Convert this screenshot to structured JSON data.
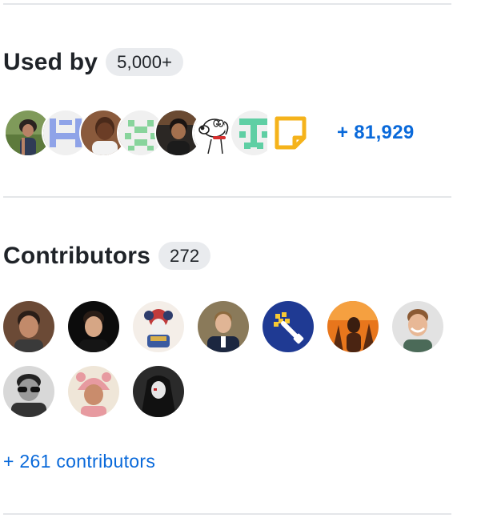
{
  "used_by": {
    "title": "Used by",
    "count": "5,000+",
    "more": "+ 81,929",
    "avatars": [
      {
        "name": "user-avatar-1",
        "kind": "photo"
      },
      {
        "name": "user-avatar-2",
        "kind": "identicon"
      },
      {
        "name": "user-avatar-3",
        "kind": "photo"
      },
      {
        "name": "user-avatar-4",
        "kind": "identicon"
      },
      {
        "name": "user-avatar-5",
        "kind": "photo"
      },
      {
        "name": "user-avatar-6",
        "kind": "cartoon-dog"
      },
      {
        "name": "user-avatar-7",
        "kind": "identicon"
      },
      {
        "name": "user-avatar-8",
        "kind": "logo"
      }
    ]
  },
  "contributors": {
    "title": "Contributors",
    "count": "272",
    "more": "+ 261 contributors",
    "avatars": [
      {
        "name": "contributor-avatar-1",
        "kind": "photo"
      },
      {
        "name": "contributor-avatar-2",
        "kind": "photo"
      },
      {
        "name": "contributor-avatar-3",
        "kind": "illustration"
      },
      {
        "name": "contributor-avatar-4",
        "kind": "photo"
      },
      {
        "name": "contributor-avatar-5",
        "kind": "logo"
      },
      {
        "name": "contributor-avatar-6",
        "kind": "photo"
      },
      {
        "name": "contributor-avatar-7",
        "kind": "photo"
      },
      {
        "name": "contributor-avatar-8",
        "kind": "photo"
      },
      {
        "name": "contributor-avatar-9",
        "kind": "photo"
      },
      {
        "name": "contributor-avatar-10",
        "kind": "illustration"
      }
    ]
  },
  "colors": {
    "link": "#0969da",
    "counter_bg": "#e9ebee",
    "divider": "#e4e6e9",
    "text": "#1f2328"
  }
}
